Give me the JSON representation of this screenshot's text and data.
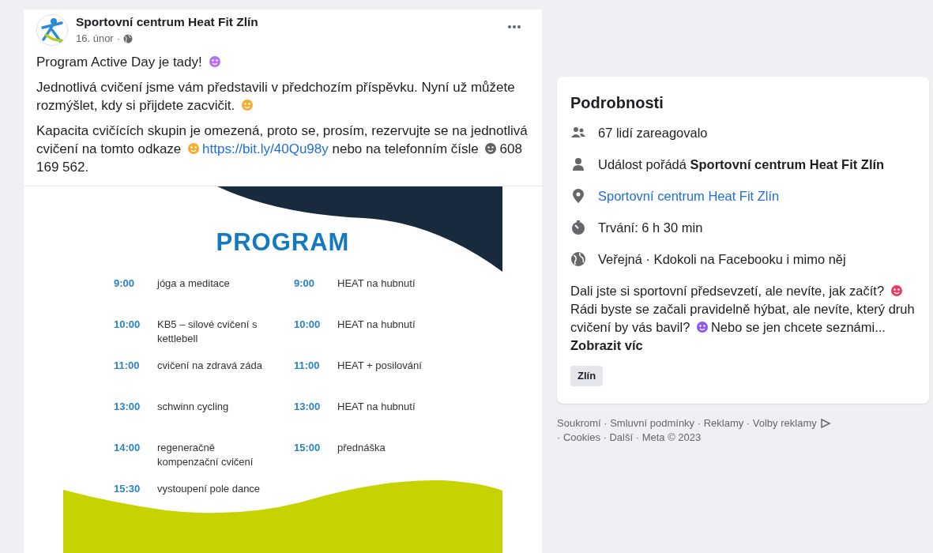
{
  "post": {
    "author": "Sportovní centrum Heat Fit Zlín",
    "date": "16. únor",
    "separator": "·",
    "paragraphs": [
      [
        {
          "kind": "text",
          "text": "Program Active Day je tady!"
        },
        {
          "kind": "emoji"
        }
      ],
      [
        {
          "kind": "text",
          "text": "Jednotlivá cvičení jsme vám představili v předchozím příspěvku. Nyní už můžete rozmýšlet, kdy si přijdete zacvičit."
        },
        {
          "kind": "emoji"
        }
      ],
      [
        {
          "kind": "text",
          "text": "Kapacita cvičících skupin je omezená, proto se, prosím, rezervujte se na jednotlivá cvičení na tomto odkaze"
        },
        {
          "kind": "emoji"
        },
        {
          "kind": "link",
          "text": "https://bit.ly/40Qu98y"
        },
        {
          "kind": "text",
          "text": "nebo na telefonním čísle"
        },
        {
          "kind": "emoji"
        },
        {
          "kind": "text",
          "text": "608 169 562."
        }
      ]
    ],
    "flyer": {
      "title": "PROGRAM",
      "columns": [
        [
          {
            "time": "9:00",
            "activity": "jóga a meditace"
          },
          {
            "time": "10:00",
            "activity": "KB5 – silové cvičení s kettlebell"
          },
          {
            "time": "11:00",
            "activity": "cvičení na zdravá záda"
          },
          {
            "time": "13:00",
            "activity": "schwinn cycling"
          },
          {
            "time": "14:00",
            "activity": "regeneračně kompenzační cvičení"
          },
          {
            "time": "15:30",
            "activity": "vystoupení pole dance"
          }
        ],
        [
          {
            "time": "9:00",
            "activity": "HEAT na hubnutí"
          },
          {
            "time": "10:00",
            "activity": "HEAT na hubnutí"
          },
          {
            "time": "11:00",
            "activity": "HEAT + posilování"
          },
          {
            "time": "13:00",
            "activity": "HEAT na hubnutí"
          },
          {
            "time": "15:00",
            "activity": "přednáška"
          }
        ]
      ]
    }
  },
  "details": {
    "title": "Podrobnosti",
    "rows": [
      {
        "kind": "people",
        "text": "67 lidí zareagovalo"
      },
      {
        "kind": "person",
        "text": "Událost pořádá **Sportovní centrum Heat Fit Zlín**"
      },
      {
        "kind": "location",
        "text": "Sportovní centrum Heat Fit Zlín",
        "link": true
      },
      {
        "kind": "duration",
        "text": "Trvání: 6 h 30 min"
      },
      {
        "kind": "globe",
        "text": "Veřejná · Kdokoli na Facebooku i mimo něj"
      }
    ],
    "description": [
      {
        "kind": "text",
        "text": "Dali jste si sportovní předsevzetí, ale nevíte, jak začít?"
      },
      {
        "kind": "emoji"
      },
      {
        "kind": "text",
        "text": "Rádi byste se začali pravidelně hýbat, ale nevíte, který druh cvičení by vás bavil?"
      },
      {
        "kind": "emoji"
      },
      {
        "kind": "text",
        "text": "Nebo se jen chcete seznámi..."
      },
      {
        "kind": "link",
        "text": "Zobrazit víc"
      }
    ],
    "tag": "Zlín"
  },
  "footer": [
    "Soukromí · Smluvní podmínky · Reklamy · Volby reklamy",
    "· Cookies · Další · Meta © 2023"
  ]
}
